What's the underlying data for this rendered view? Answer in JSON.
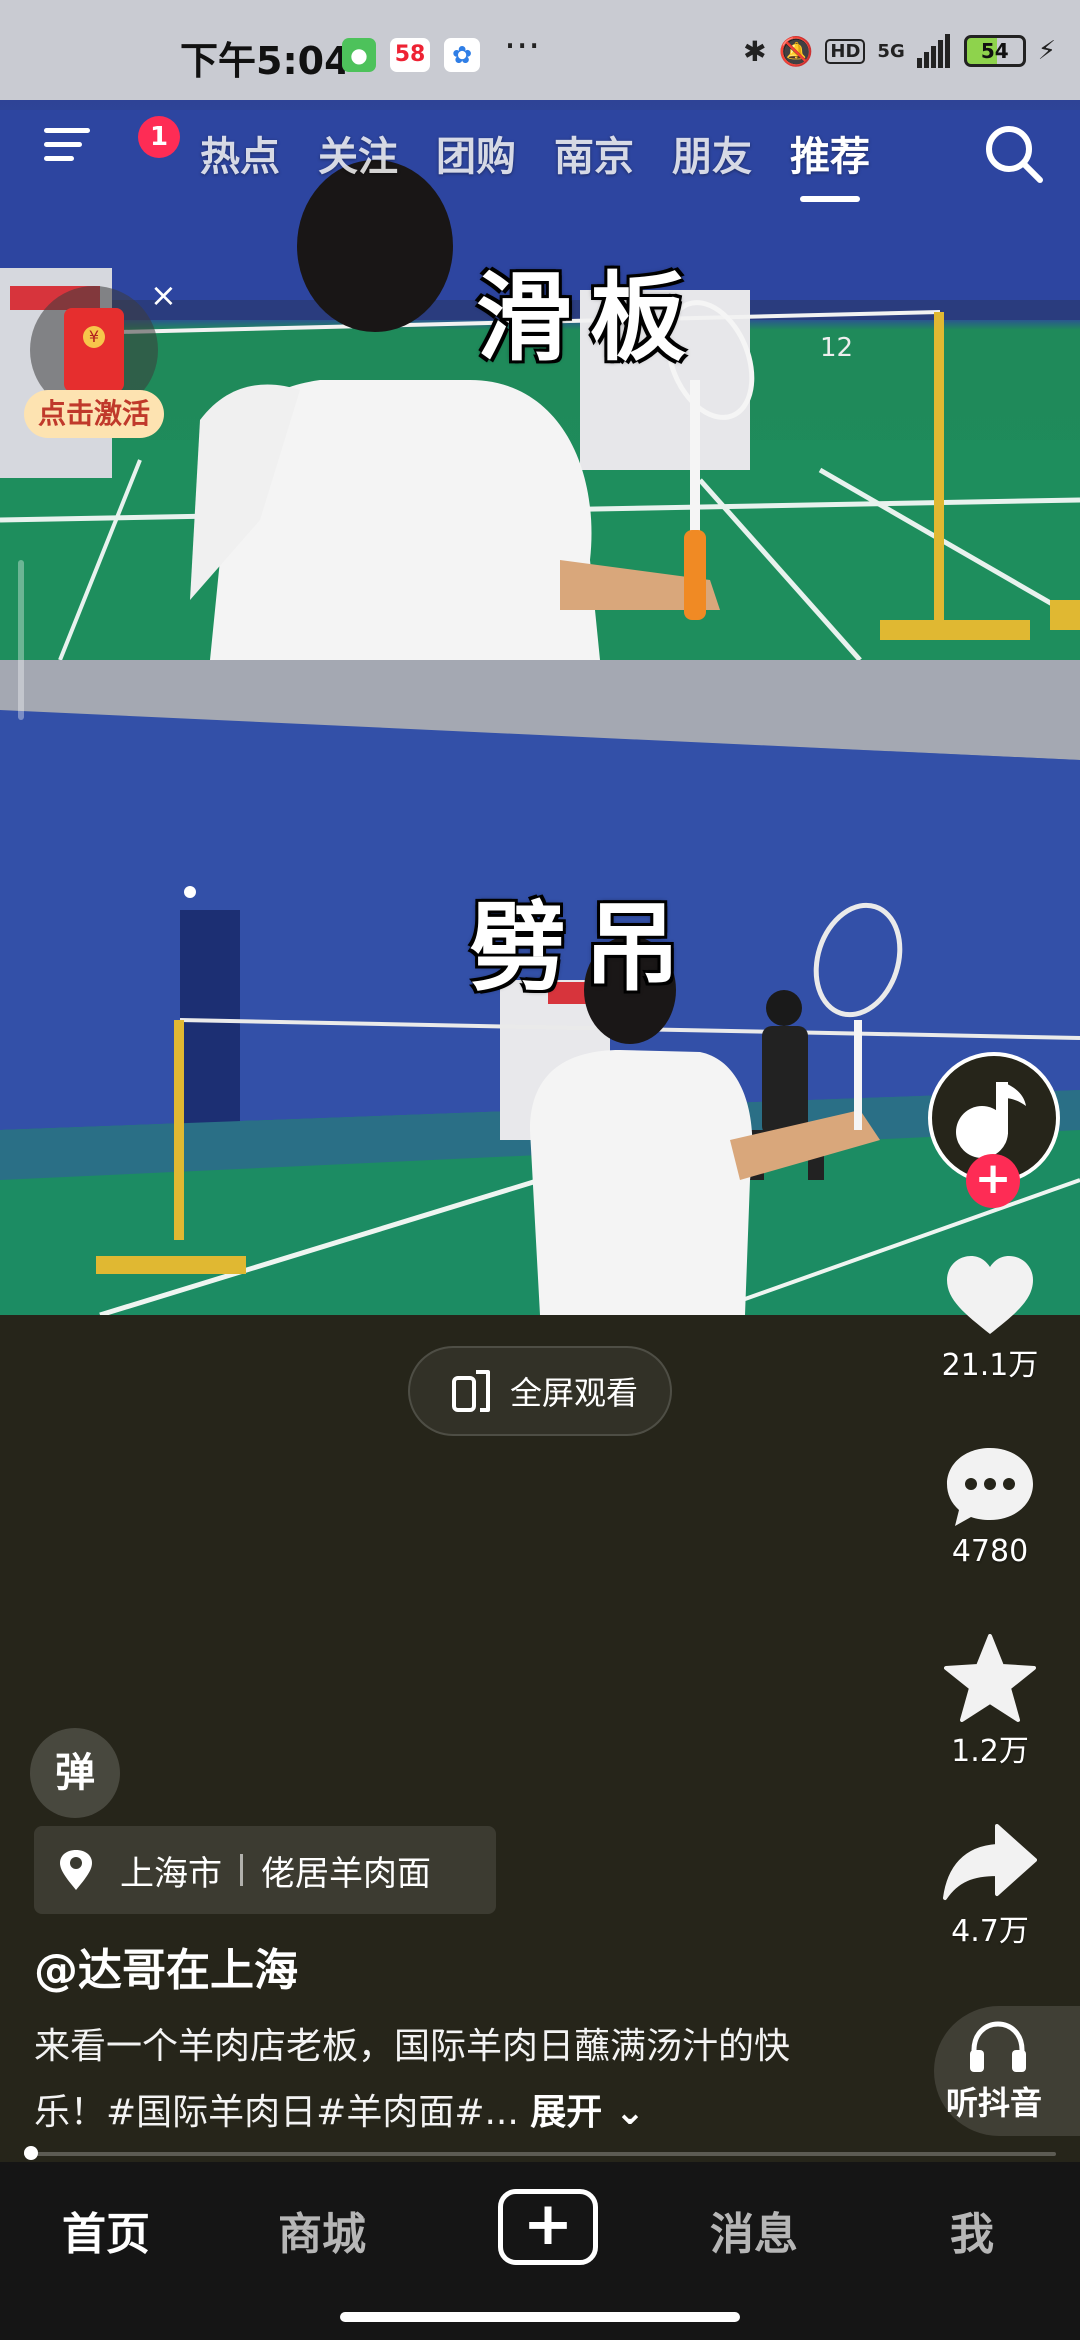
{
  "status_bar": {
    "time": "下午5:04",
    "app_icon_58_label": "58",
    "network_label": "5G",
    "hd_label": "HD",
    "battery": "54"
  },
  "top_nav": {
    "menu_badge": "1",
    "tabs": [
      {
        "label": "热点",
        "active": false
      },
      {
        "label": "关注",
        "active": false
      },
      {
        "label": "团购",
        "active": false
      },
      {
        "label": "南京",
        "active": false
      },
      {
        "label": "朋友",
        "active": false
      },
      {
        "label": "推荐",
        "active": true
      }
    ]
  },
  "red_packet": {
    "label": "点击激活"
  },
  "video": {
    "caption_top": "滑板",
    "caption_bottom": "劈吊",
    "fullscreen_label": "全屏观看"
  },
  "right_rail": {
    "likes": "21.1万",
    "comments": "4780",
    "favorites": "1.2万",
    "shares": "4.7万",
    "listen_label": "听抖音"
  },
  "info": {
    "danmu_label": "弹",
    "location_city": "上海市",
    "location_place": "佬居羊肉面",
    "author": "@达哥在上海",
    "description": "来看一个羊肉店老板，国际羊肉日蘸满汤汁的快乐！#国际羊肉日#羊肉面#...",
    "expand_label": "展开"
  },
  "bottom_nav": {
    "home": "首页",
    "mall": "商城",
    "plus": "+",
    "messages": "消息",
    "me": "我"
  },
  "colors": {
    "accent": "#fe2c55",
    "background": "#26251a",
    "nav_background": "#151515"
  }
}
